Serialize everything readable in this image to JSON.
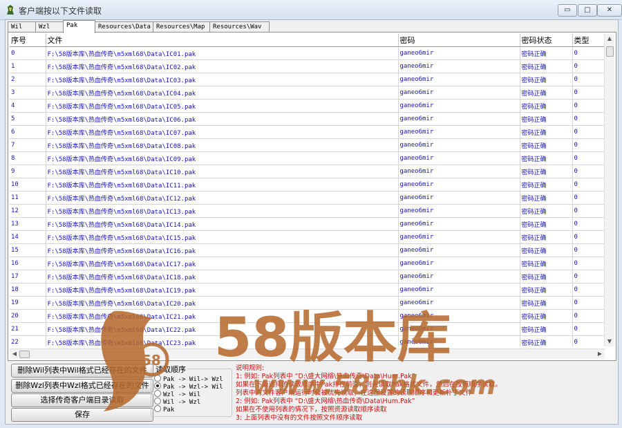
{
  "window": {
    "title": "客户端按以下文件读取",
    "minimize": "▭",
    "maximize": "□",
    "close": "✕"
  },
  "tabs": [
    "Wil",
    "Wzl",
    "Pak",
    "Resources\\Data",
    "Resources\\Map",
    "Resources\\Wav"
  ],
  "table": {
    "headers": [
      "序号",
      "文件",
      "密码",
      "密码状态",
      "类型"
    ],
    "rows": [
      [
        "0",
        "F:\\58版本库\\热血传奇\\m5xml68\\Data\\IC01.pak",
        "ganeo6mir",
        "密码正确",
        "0"
      ],
      [
        "1",
        "F:\\58版本库\\热血传奇\\m5xml68\\Data\\IC02.pak",
        "ganeo6mir",
        "密码正确",
        "0"
      ],
      [
        "2",
        "F:\\58版本库\\热血传奇\\m5xml68\\Data\\IC03.pak",
        "ganeo6mir",
        "密码正确",
        "0"
      ],
      [
        "3",
        "F:\\58版本库\\热血传奇\\m5xml68\\Data\\IC04.pak",
        "ganeo6mir",
        "密码正确",
        "0"
      ],
      [
        "4",
        "F:\\58版本库\\热血传奇\\m5xml68\\Data\\IC05.pak",
        "ganeo6mir",
        "密码正确",
        "0"
      ],
      [
        "5",
        "F:\\58版本库\\热血传奇\\m5xml68\\Data\\IC06.pak",
        "ganeo6mir",
        "密码正确",
        "0"
      ],
      [
        "6",
        "F:\\58版本库\\热血传奇\\m5xml68\\Data\\IC07.pak",
        "ganeo6mir",
        "密码正确",
        "0"
      ],
      [
        "7",
        "F:\\58版本库\\热血传奇\\m5xml68\\Data\\IC08.pak",
        "ganeo6mir",
        "密码正确",
        "0"
      ],
      [
        "8",
        "F:\\58版本库\\热血传奇\\m5xml68\\Data\\IC09.pak",
        "ganeo6mir",
        "密码正确",
        "0"
      ],
      [
        "9",
        "F:\\58版本库\\热血传奇\\m5xml68\\Data\\IC10.pak",
        "ganeo6mir",
        "密码正确",
        "0"
      ],
      [
        "10",
        "F:\\58版本库\\热血传奇\\m5xml68\\Data\\IC11.pak",
        "ganeo6mir",
        "密码正确",
        "0"
      ],
      [
        "11",
        "F:\\58版本库\\热血传奇\\m5xml68\\Data\\IC12.pak",
        "ganeo6mir",
        "密码正确",
        "0"
      ],
      [
        "12",
        "F:\\58版本库\\热血传奇\\m5xml68\\Data\\IC13.pak",
        "ganeo6mir",
        "密码正确",
        "0"
      ],
      [
        "13",
        "F:\\58版本库\\热血传奇\\m5xml68\\Data\\IC14.pak",
        "ganeo6mir",
        "密码正确",
        "0"
      ],
      [
        "14",
        "F:\\58版本库\\热血传奇\\m5xml68\\Data\\IC15.pak",
        "ganeo6mir",
        "密码正确",
        "0"
      ],
      [
        "15",
        "F:\\58版本库\\热血传奇\\m5xml68\\Data\\IC16.pak",
        "ganeo6mir",
        "密码正确",
        "0"
      ],
      [
        "16",
        "F:\\58版本库\\热血传奇\\m5xml68\\Data\\IC17.pak",
        "ganeo6mir",
        "密码正确",
        "0"
      ],
      [
        "17",
        "F:\\58版本库\\热血传奇\\m5xml68\\Data\\IC18.pak",
        "ganeo6mir",
        "密码正确",
        "0"
      ],
      [
        "18",
        "F:\\58版本库\\热血传奇\\m5xml68\\Data\\IC19.pak",
        "ganeo6mir",
        "密码正确",
        "0"
      ],
      [
        "19",
        "F:\\58版本库\\热血传奇\\m5xml68\\Data\\IC20.pak",
        "ganeo6mir",
        "密码正确",
        "0"
      ],
      [
        "20",
        "F:\\58版本库\\热血传奇\\m5xml68\\Data\\IC21.pak",
        "ganeo6mir",
        "密码正确",
        "0"
      ],
      [
        "21",
        "F:\\58版本库\\热血传奇\\m5xml68\\Data\\IC22.pak",
        "ganeo6mir",
        "密码正确",
        "0"
      ],
      [
        "22",
        "F:\\58版本库\\热血传奇\\m5xml68\\Data\\IC23.pak",
        "ganeo6mir",
        "密码正确",
        "0"
      ]
    ]
  },
  "buttons": {
    "delete_wil": "删除Wil列表中Wil格式已经存在的文件",
    "delete_wzl": "删除Wzl列表中Wzl格式已经存在的文件",
    "select_client_dir": "选择传奇客户端目录读取",
    "save": "保存"
  },
  "read_order": {
    "title": "读取顺序",
    "options": [
      "Pak -> Wil-> Wzl",
      "Pak -> Wzl-> Wil",
      "Wzl -> Wil",
      "Wil -> Wzl",
      "Pak"
    ],
    "selected": 1
  },
  "notes": [
    "说明规则:",
    "1: 例如: Pak列表中 “D:\\盛大网络\\热血传奇\\Data\\Hum.Pak”",
    "   如果在下面选择的读取顺序中Pak排在前面，则先读取Pak格式文件，然后在按照顺序读取。",
    "   列表中的文件客户端运行时会被优先读取，在这里设置的读取顺序和更新补丁文件",
    "2: 例如: Pak列表中 “D:\\盛大网络\\热血传奇\\Data\\Hum.Pak”",
    "   如果在不使用列表的情况下，按照资源读取顺序读取",
    "3: 上面列表中没有的文件按照文件顺序读取"
  ],
  "watermark": {
    "brand": "58版本库",
    "url": "www.58bbk.com",
    "badge": "58"
  },
  "colors": {
    "link_blue": "#1515b8",
    "note_red": "#cc1010",
    "watermark_brown": "#b5672a"
  }
}
